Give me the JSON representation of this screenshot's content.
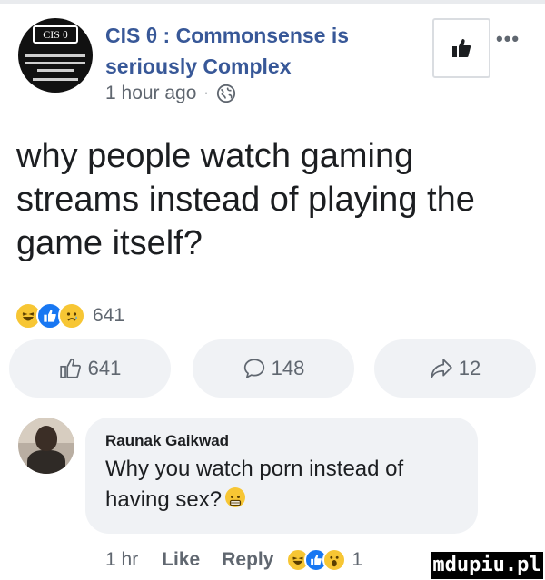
{
  "post": {
    "page_avatar_badge": "CIS θ",
    "page_name": "CIS θ : Commonsense is seriously Complex",
    "time": "1 hour ago",
    "separator": "·",
    "privacy_icon": "globe-icon",
    "like_page_icon": "thumbs-up-icon",
    "more_label": "•••",
    "text": "why people watch gaming streams instead of playing the game itself?",
    "reactions": {
      "icons": [
        "haha-emoji-icon",
        "like-reaction-icon",
        "sad-emoji-icon"
      ],
      "count": "641"
    },
    "actions": {
      "like_count": "641",
      "comment_count": "148",
      "share_count": "12"
    }
  },
  "comment": {
    "author": "Raunak Gaikwad",
    "text": "Why you watch porn instead of having sex?",
    "emoji_icon": "grimace-emoji-icon",
    "time": "1 hr",
    "like_label": "Like",
    "reply_label": "Reply",
    "reaction_icons": [
      "haha-emoji-icon",
      "like-reaction-icon",
      "wow-emoji-icon"
    ],
    "reaction_count": "1"
  },
  "watermark": "mdupiu.pl",
  "colors": {
    "link_blue": "#385898",
    "facebook_blue": "#1877f2",
    "text": "#1c1e21",
    "muted": "#606770",
    "pill_bg": "#f0f2f5",
    "emoji_yellow": "#f7c634"
  }
}
